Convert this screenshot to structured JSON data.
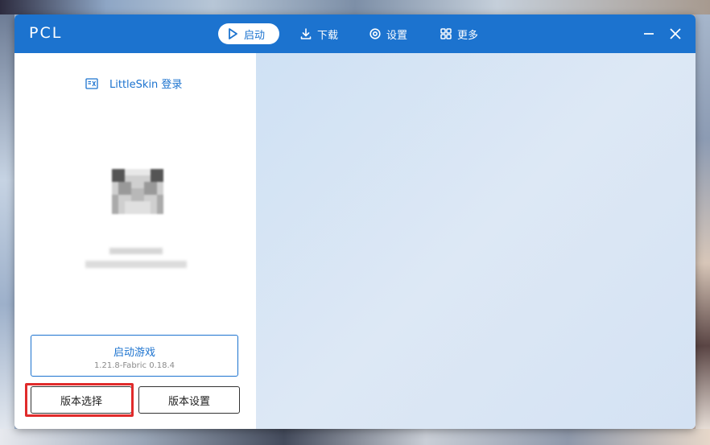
{
  "app": {
    "title": "PCL"
  },
  "nav": {
    "launch": {
      "label": "启动",
      "icon": "play-icon"
    },
    "download": {
      "label": "下载",
      "icon": "download-icon"
    },
    "settings": {
      "label": "设置",
      "icon": "gear-icon"
    },
    "more": {
      "label": "更多",
      "icon": "grid-icon"
    }
  },
  "window_controls": {
    "minimize_icon": "minimize-icon",
    "close_icon": "close-icon"
  },
  "sidebar": {
    "login_label": "LittleSkin 登录",
    "launch_button": {
      "title": "启动游戏",
      "version": "1.21.8-Fabric 0.18.4"
    },
    "version_select_label": "版本选择",
    "version_settings_label": "版本设置"
  },
  "colors": {
    "accent": "#1c73cf",
    "highlight": "#e02b2b",
    "main_bg": "#d6e4f4"
  }
}
